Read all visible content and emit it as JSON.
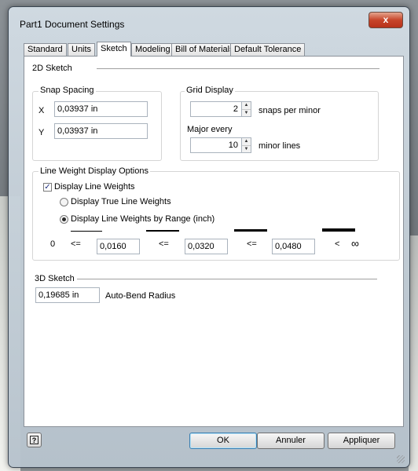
{
  "window": {
    "title": "Part1 Document Settings",
    "close_glyph": "x",
    "close_icon": "close-icon"
  },
  "tabs": [
    {
      "label": "Standard",
      "active": false
    },
    {
      "label": "Units",
      "active": false
    },
    {
      "label": "Sketch",
      "active": true
    },
    {
      "label": "Modeling",
      "active": false
    },
    {
      "label": "Bill of Materials",
      "active": false
    },
    {
      "label": "Default Tolerance",
      "active": false
    }
  ],
  "sketch2d": {
    "title": "2D Sketch",
    "snap_spacing": {
      "title": "Snap Spacing",
      "x_label": "X",
      "x_value": "0,03937 in",
      "y_label": "Y",
      "y_value": "0,03937 in"
    },
    "grid_display": {
      "title": "Grid Display",
      "snaps_value": "2",
      "snaps_label": "snaps per minor",
      "major_label": "Major every",
      "major_value": "10",
      "major_suffix": "minor lines"
    },
    "line_weight": {
      "title": "Line Weight Display Options",
      "display_checkbox": {
        "label": "Display Line Weights",
        "checked": true,
        "glyph": "✓"
      },
      "radio_true": {
        "label": "Display True Line Weights",
        "selected": false
      },
      "radio_range": {
        "label": "Display Line Weights by Range (inch)",
        "selected": true
      },
      "range": {
        "start": "0",
        "le": "<=",
        "lt": "<",
        "infinity": "∞",
        "values": [
          "0,0160",
          "0,0320",
          "0,0480"
        ]
      }
    }
  },
  "sketch3d": {
    "title": "3D Sketch",
    "radius_value": "0,19685 in",
    "radius_label": "Auto-Bend Radius"
  },
  "footer": {
    "help_glyph": "?",
    "ok_label": "OK",
    "cancel_label": "Annuler",
    "apply_label": "Appliquer"
  },
  "colors": {
    "close_button": "#c7452a",
    "accent": "#3c7fb1"
  }
}
